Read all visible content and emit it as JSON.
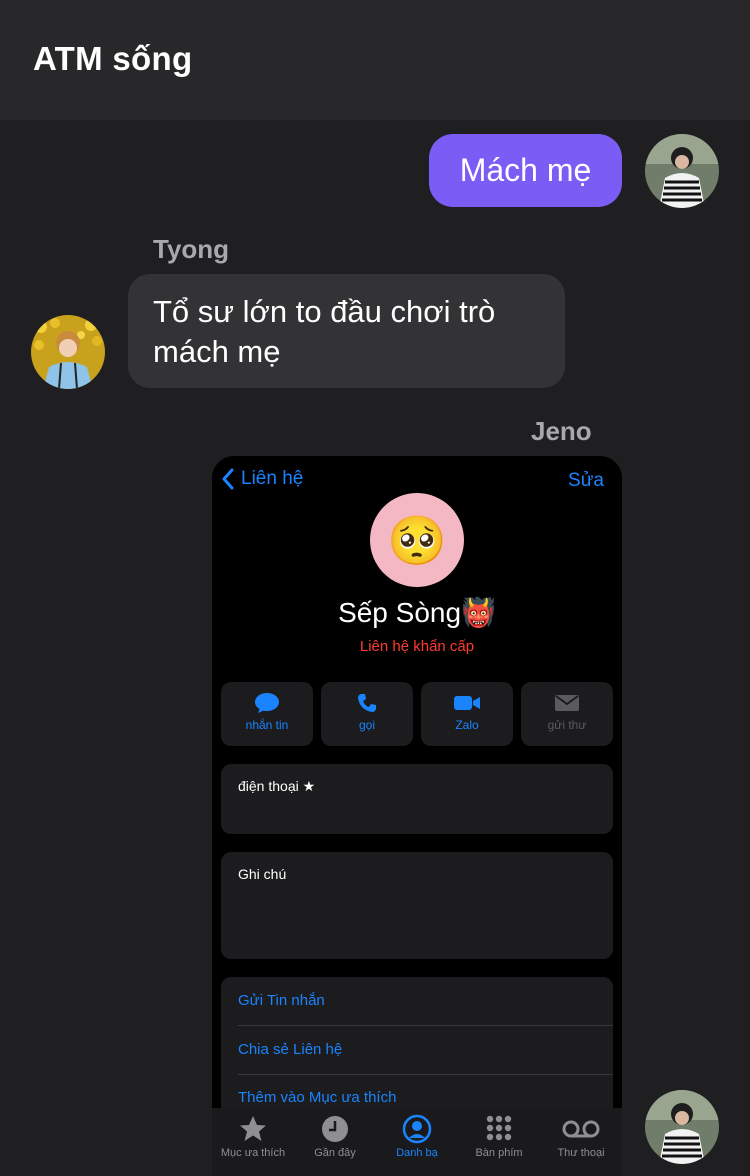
{
  "header": {
    "title": "ATM sống"
  },
  "messages": {
    "outgoing": {
      "text": "Mách mẹ"
    },
    "tyong": {
      "sender": "Tyong",
      "text": "Tổ sư lớn to đầu chơi trò mách mẹ"
    },
    "jeno": {
      "sender": "Jeno"
    }
  },
  "shared_image": {
    "nav": {
      "back_label": "Liên hệ",
      "edit_label": "Sửa"
    },
    "contact": {
      "name": "Sếp Sòng👹",
      "subtitle": "Liên hệ khẩn cấp",
      "avatar_emoji": "🥺"
    },
    "actions": [
      {
        "label": "nhắn tin",
        "icon": "message-bubble-icon"
      },
      {
        "label": "gọi",
        "icon": "phone-icon"
      },
      {
        "label": "Zalo",
        "icon": "video-camera-icon"
      },
      {
        "label": "gửi thư",
        "icon": "envelope-icon"
      }
    ],
    "phone_label": "điện thoại ★",
    "notes_label": "Ghi chú",
    "links": [
      "Gửi Tin nhắn",
      "Chia sẻ Liên hệ",
      "Thêm vào Mục ưa thích"
    ],
    "tabs": [
      {
        "label": "Mục ưa thích",
        "icon": "star-icon"
      },
      {
        "label": "Gần đây",
        "icon": "clock-icon"
      },
      {
        "label": "Danh bạ",
        "icon": "person-circle-icon"
      },
      {
        "label": "Bàn phím",
        "icon": "keypad-icon"
      },
      {
        "label": "Thư thoại",
        "icon": "voicemail-icon"
      }
    ],
    "active_tab": "Danh bạ"
  },
  "colors": {
    "outgoing_bubble": "#7b5cf4",
    "incoming_bubble": "#333335",
    "background": "#1f1f21",
    "link_blue": "#1a84ff",
    "emergency_red": "#ff3b30"
  }
}
